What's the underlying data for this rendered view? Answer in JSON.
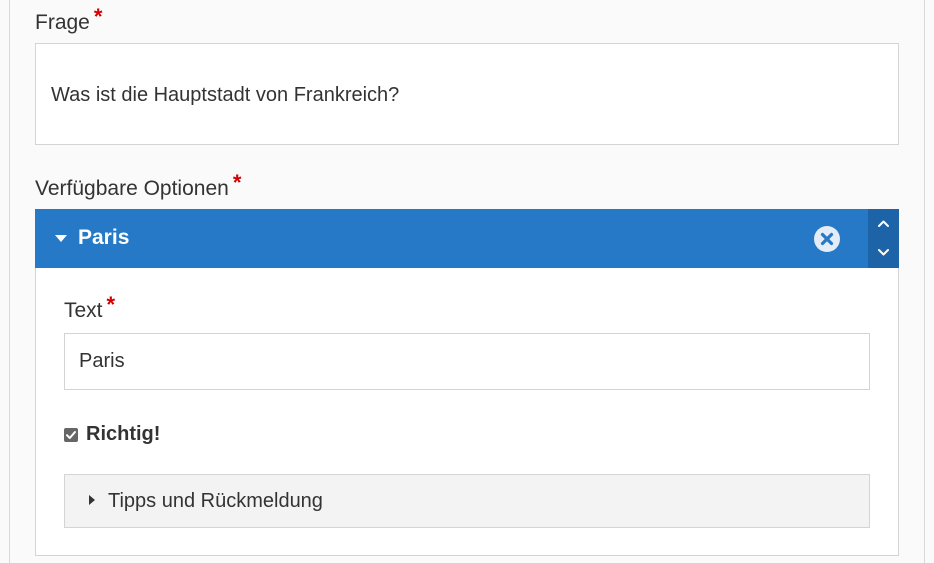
{
  "question_field": {
    "label": "Frage",
    "required_mark": "*",
    "value": "Was ist die Hauptstadt von Frankreich?"
  },
  "options_field": {
    "label": "Verfügbare Optionen",
    "required_mark": "*",
    "items": [
      {
        "title": "Paris",
        "text_label": "Text",
        "text_required_mark": "*",
        "text_value": "Paris",
        "correct_label": "Richtig!",
        "correct_checked": true,
        "tips_label": "Tipps und Rückmeldung"
      }
    ]
  },
  "colors": {
    "accent": "#2579c6",
    "accent_dark": "#1d63a8",
    "required": "#d20000"
  },
  "icons": {
    "collapse": "caret-down-icon",
    "remove": "circle-x-icon",
    "move_up": "chevron-up-icon",
    "move_down": "chevron-down-icon",
    "expand_tips": "caret-right-icon",
    "checkbox": "checkbox-checked-icon"
  }
}
